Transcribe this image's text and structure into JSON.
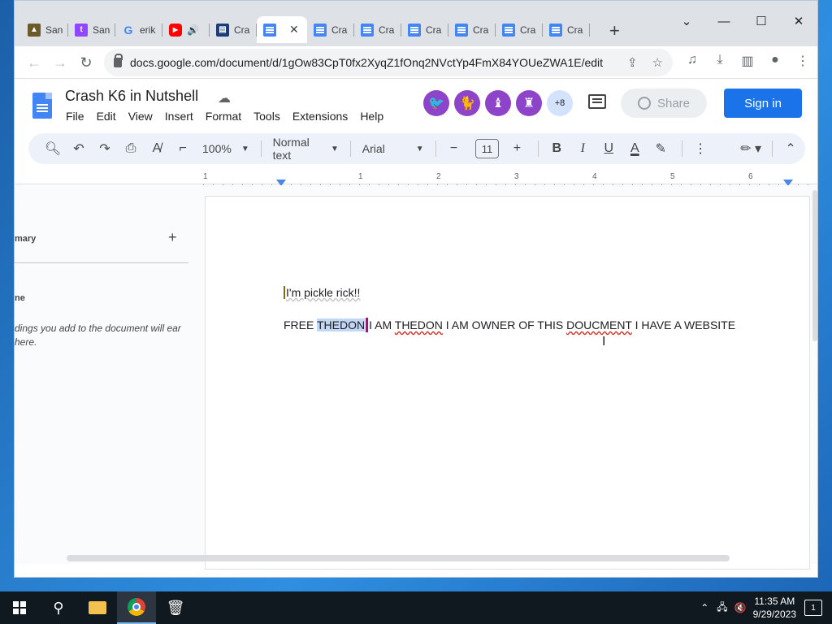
{
  "browser": {
    "tabs": [
      {
        "label": "San",
        "icon": "image-favicon-icon",
        "color": "#6b5a2a"
      },
      {
        "label": "San",
        "icon": "twitch-icon",
        "color": "#9146ff"
      },
      {
        "label": "erik",
        "icon": "google-icon",
        "color": "#ffffff"
      },
      {
        "label": "",
        "icon": "youtube-icon",
        "color": "#ff0000"
      },
      {
        "label": "Cra",
        "icon": "docs-icon",
        "color": "#4285f4"
      },
      {
        "label": "",
        "icon": "docs-icon",
        "color": "#4285f4"
      },
      {
        "label": "Cra",
        "icon": "docs-icon",
        "color": "#4285f4"
      },
      {
        "label": "Cra",
        "icon": "docs-icon",
        "color": "#4285f4"
      },
      {
        "label": "Cra",
        "icon": "docs-icon",
        "color": "#4285f4"
      },
      {
        "label": "Cra",
        "icon": "docs-icon",
        "color": "#4285f4"
      },
      {
        "label": "Cra",
        "icon": "docs-icon",
        "color": "#4285f4"
      },
      {
        "label": "Cra",
        "icon": "docs-icon",
        "color": "#4285f4"
      }
    ],
    "url": "docs.google.com/document/d/1gOw83CpT0fx2XyqZ1fOnq2NVctYp4FmX84YOUeZWA1E/edit"
  },
  "docs": {
    "title": "Crash K6 in Nutshell",
    "menu": [
      "File",
      "Edit",
      "View",
      "Insert",
      "Format",
      "Tools",
      "Extensions",
      "Help"
    ],
    "collaborators_more": "+8",
    "share_label": "Share",
    "signin_label": "Sign in",
    "zoom": "100%",
    "style": "Normal text",
    "font": "Arial",
    "font_size": "11"
  },
  "ruler": {
    "numbers": [
      "1",
      "1",
      "2",
      "3",
      "4",
      "5",
      "6"
    ]
  },
  "outline": {
    "summary": "mary",
    "heading": "ne",
    "note": "dings you add to the document will ear here."
  },
  "document": {
    "line1": "I'm pickle rick!!",
    "line2_a": "FREE ",
    "line2_sel": "THEDON",
    "line2_b": "I AM ",
    "line2_err1": "THEDON",
    "line2_c": " I AM OWNER OF THIS ",
    "line2_err2": "DOUCMENT",
    "line2_d": " I HAVE A WEBSITE"
  },
  "taskbar": {
    "time": "11:35 AM",
    "date": "9/29/2023",
    "notifications": "1"
  },
  "colors": {
    "accent": "#1a73e8",
    "avatar": "#8e44c9",
    "selection": "#c2d7f5"
  }
}
